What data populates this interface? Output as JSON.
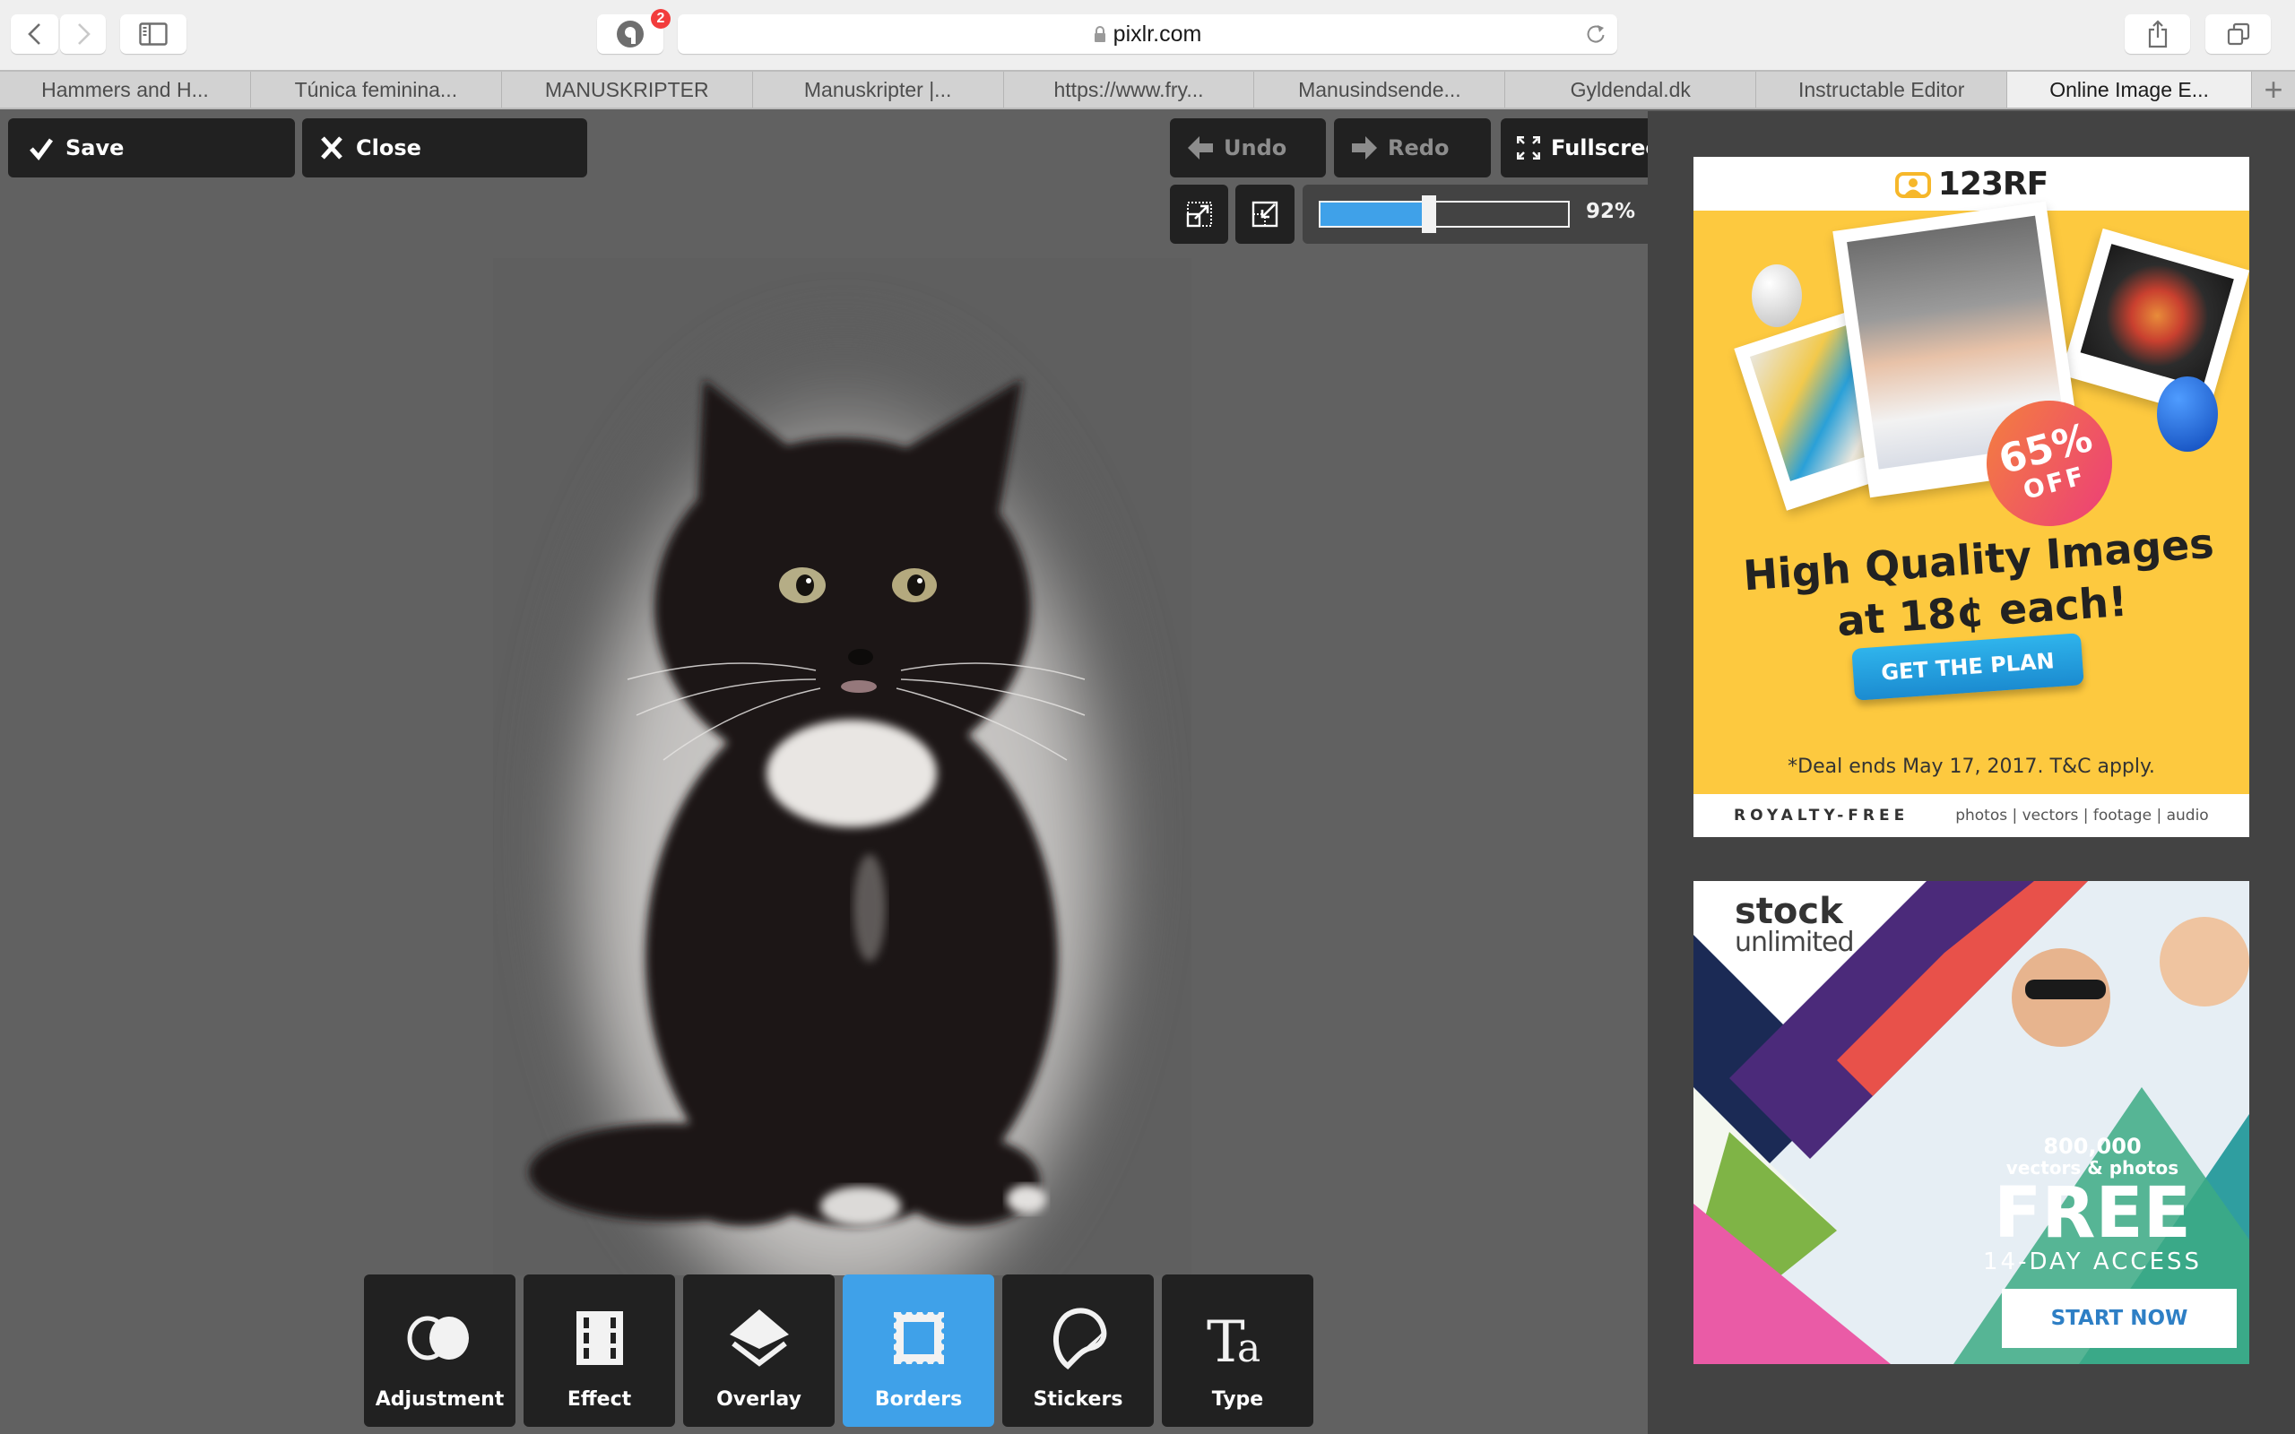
{
  "browser": {
    "url": "pixlr.com",
    "extension_badge_count": "2",
    "tabs": [
      {
        "label": "Hammers and H...",
        "active": false
      },
      {
        "label": "Túnica feminina...",
        "active": false
      },
      {
        "label": "MANUSKRIPTER",
        "active": false
      },
      {
        "label": "Manuskripter |...",
        "active": false
      },
      {
        "label": "https://www.fry...",
        "active": false
      },
      {
        "label": "Manusindsende...",
        "active": false
      },
      {
        "label": "Gyldendal.dk",
        "active": false
      },
      {
        "label": "Instructable Editor",
        "active": false
      },
      {
        "label": "Online Image E...",
        "active": true
      }
    ],
    "new_tab_label": "+",
    "icons": {
      "back": "chevron-left-icon",
      "forward": "chevron-right-icon",
      "sidebar": "sidebar-icon",
      "extension": "extension-icon",
      "lock": "lock-icon",
      "reload": "reload-icon",
      "share": "share-icon",
      "tabs": "tabs-overview-icon"
    }
  },
  "editor": {
    "save_label": "Save",
    "close_label": "Close",
    "undo_label": "Undo",
    "redo_label": "Redo",
    "fullscreen_label": "Fullscreen",
    "zoom": {
      "value_label": "92%",
      "slider_fraction": 0.44,
      "accent_color": "#3fa1e9"
    },
    "canvas_image": "black and white long-haired kitten with soft white vignette border",
    "tools": [
      {
        "label": "Adjustment",
        "icon": "adjustment-icon",
        "active": false
      },
      {
        "label": "Effect",
        "icon": "film-icon",
        "active": false
      },
      {
        "label": "Overlay",
        "icon": "layers-icon",
        "active": false
      },
      {
        "label": "Borders",
        "icon": "stamp-border-icon",
        "active": true
      },
      {
        "label": "Stickers",
        "icon": "sticker-icon",
        "active": false
      },
      {
        "label": "Type",
        "icon": "type-icon",
        "active": false
      }
    ]
  },
  "ads": {
    "ad1": {
      "brand": "123RF",
      "badge_pct": "65%",
      "badge_off": "OFF",
      "headline_line1": "High Quality Images",
      "headline_line2": "at 18¢ each!",
      "cta": "GET THE PLAN",
      "fineprint": "*Deal ends May 17, 2017. T&C apply.",
      "footer_left": "ROYALTY-FREE",
      "footer_right": "photos | vectors | footage | audio",
      "bg_color": "#fdc93f"
    },
    "ad2": {
      "brand_line1": "stock",
      "brand_line2": "unlimited",
      "count": "800,000",
      "subtitle": "vectors & photos",
      "headline": "FREE",
      "access": "14-DAY ACCESS",
      "cta": "START NOW"
    }
  }
}
